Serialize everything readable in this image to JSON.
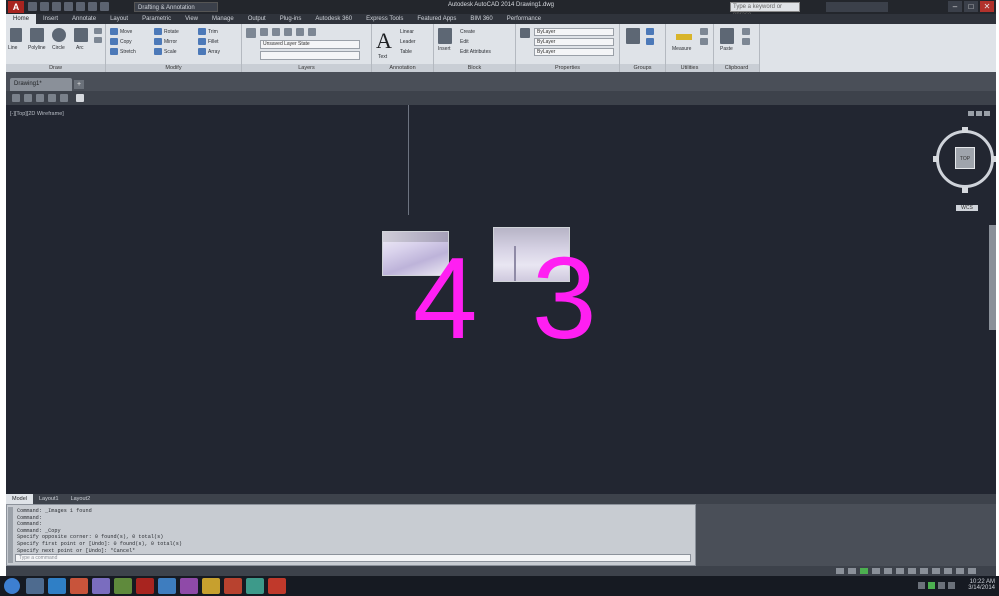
{
  "titlebar": {
    "app_logo": "A",
    "workspace": "Drafting & Annotation",
    "window_title": "Autodesk AutoCAD 2014  Drawing1.dwg",
    "search_placeholder": "Type a keyword or phrase",
    "controls": [
      "–",
      "□",
      "✕"
    ]
  },
  "ribbon": {
    "tabs": [
      "Home",
      "Insert",
      "Annotate",
      "Layout",
      "Parametric",
      "View",
      "Manage",
      "Output",
      "Plug-ins",
      "Autodesk 360",
      "Express Tools",
      "Featured Apps",
      "BIM 360",
      "Performance"
    ],
    "active_tab": 0,
    "panels": [
      {
        "title": "Draw"
      },
      {
        "title": "Modify"
      },
      {
        "title": "Layers"
      },
      {
        "title": "Annotation"
      },
      {
        "title": "Block"
      },
      {
        "title": "Properties"
      },
      {
        "title": "Groups"
      },
      {
        "title": "Utilities"
      },
      {
        "title": "Clipboard"
      }
    ],
    "draw_labels": [
      "Line",
      "Polyline",
      "Circle",
      "Arc"
    ],
    "modify_labels": [
      "Move",
      "Copy",
      "Stretch",
      "Rotate",
      "Mirror",
      "Scale",
      "Trim",
      "Fillet",
      "Array"
    ],
    "layer_combo": "Unsaved Layer State",
    "text_label": "Text",
    "annotation_labels": [
      "Linear",
      "Leader",
      "Table"
    ],
    "block_labels": [
      "Insert",
      "Create",
      "Edit",
      "Edit Attributes"
    ],
    "properties_labels": [
      "ByLayer",
      "ByLayer",
      "ByLayer"
    ],
    "utilities_label": "Measure",
    "clipboard_label": "Paste"
  },
  "document": {
    "tab_label": "Drawing1*",
    "plus": "+"
  },
  "drawing": {
    "view_label": "[-][Top][2D Wireframe]",
    "viewcube_face": "TOP",
    "wcs_label": "WCS",
    "mtext": [
      "4",
      "3"
    ],
    "text_color": "#ff1ff2",
    "background_color": "#222631"
  },
  "layout_tabs": [
    "Model",
    "Layout1",
    "Layout2"
  ],
  "layout_active": 0,
  "command": {
    "history": [
      "Command:  _Images  1 found",
      "Command:",
      "Command:",
      "Command:  _Copy",
      "Specify opposite corner:  0 found(s), 0 total(s)",
      "Specify first point or [Undo]:  0 found(s), 0 total(s)",
      "Specify next point or [Undo]:  *Cancel*"
    ],
    "input_placeholder": "Type a command"
  },
  "taskbar": {
    "time": "10:22 AM",
    "date": "3/14/2014"
  }
}
